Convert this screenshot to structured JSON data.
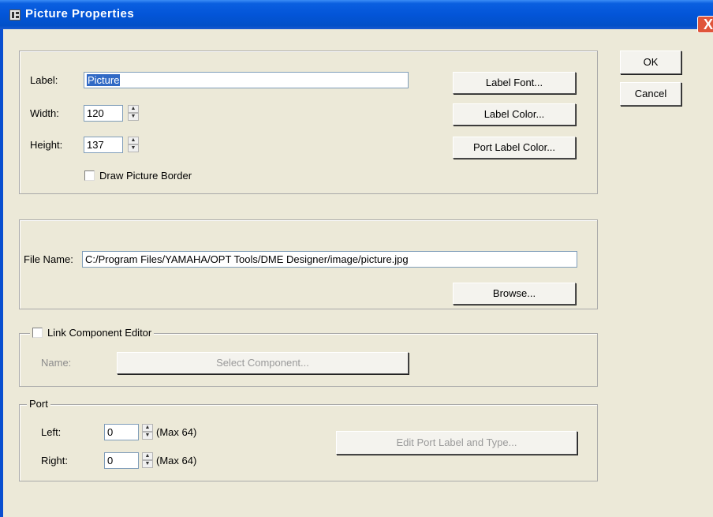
{
  "window": {
    "title": "Picture Properties",
    "close_symbol": "X"
  },
  "labels": {
    "label": "Label:",
    "width": "Width:",
    "height": "Height:",
    "draw_border": "Draw Picture Border",
    "file_name": "File Name:",
    "link_component": "Link Component Editor",
    "name": "Name:",
    "port": "Port",
    "left": "Left:",
    "right": "Right:",
    "left_max": "(Max 64)",
    "right_max": "(Max 64)"
  },
  "fields": {
    "label_value": "Picture",
    "width_value": "120",
    "height_value": "137",
    "file_name_value": "C:/Program Files/YAMAHA/OPT Tools/DME Designer/image/picture.jpg",
    "port_left_value": "0",
    "port_right_value": "0"
  },
  "checkboxes": {
    "draw_border_checked": false,
    "link_component_checked": false
  },
  "buttons": {
    "ok": "OK",
    "cancel": "Cancel",
    "label_font": "Label Font...",
    "label_color": "Label Color...",
    "port_label_color": "Port Label Color...",
    "browse": "Browse...",
    "select_component": "Select Component...",
    "edit_port": "Edit Port Label and Type..."
  },
  "icons": {
    "spin_up": "▲",
    "spin_down": "▼"
  }
}
